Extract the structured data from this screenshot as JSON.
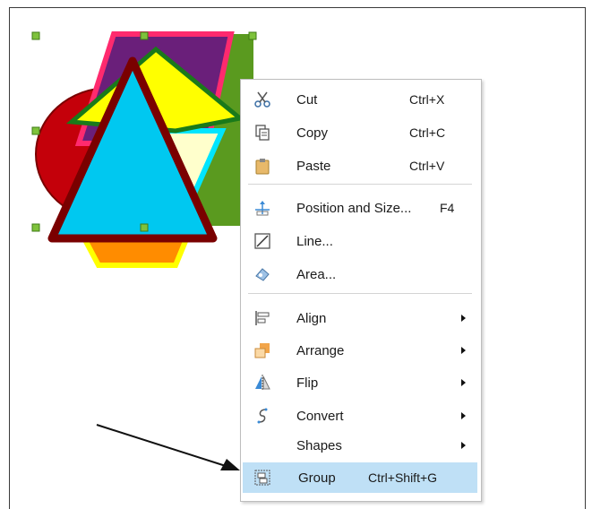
{
  "context_menu": {
    "items": [
      {
        "label": "Cut",
        "shortcut": "Ctrl+X",
        "icon": "scissors-icon"
      },
      {
        "label": "Copy",
        "shortcut": "Ctrl+C",
        "icon": "copy-icon"
      },
      {
        "label": "Paste",
        "shortcut": "Ctrl+V",
        "icon": "clipboard-icon"
      },
      {
        "label": "Position and Size...",
        "shortcut": "F4",
        "icon": "position-size-icon"
      },
      {
        "label": "Line...",
        "shortcut": "",
        "icon": "line-icon"
      },
      {
        "label": "Area...",
        "shortcut": "",
        "icon": "area-icon"
      },
      {
        "label": "Align",
        "shortcut": "",
        "icon": "align-icon",
        "submenu": true
      },
      {
        "label": "Arrange",
        "shortcut": "",
        "icon": "arrange-icon",
        "submenu": true
      },
      {
        "label": "Flip",
        "shortcut": "",
        "icon": "flip-icon",
        "submenu": true
      },
      {
        "label": "Convert",
        "shortcut": "",
        "icon": "convert-icon",
        "submenu": true
      },
      {
        "label": "Shapes",
        "shortcut": "",
        "icon": "",
        "submenu": true
      },
      {
        "label": "Group",
        "shortcut": "Ctrl+Shift+G",
        "icon": "group-icon",
        "highlighted": true
      }
    ]
  },
  "colors": {
    "highlight": "#bfe0f6",
    "triangle_fill": "#00c8f0",
    "triangle_stroke": "#7a0000",
    "diamond_fill": "#ffff00",
    "trapezoid_fill": "#6a1f7a",
    "trapezoid_stroke": "#ff2a6e",
    "green_rect": "#5a9a1f",
    "ellipse_fill": "#c4000a",
    "handle": "#7ec23b"
  }
}
